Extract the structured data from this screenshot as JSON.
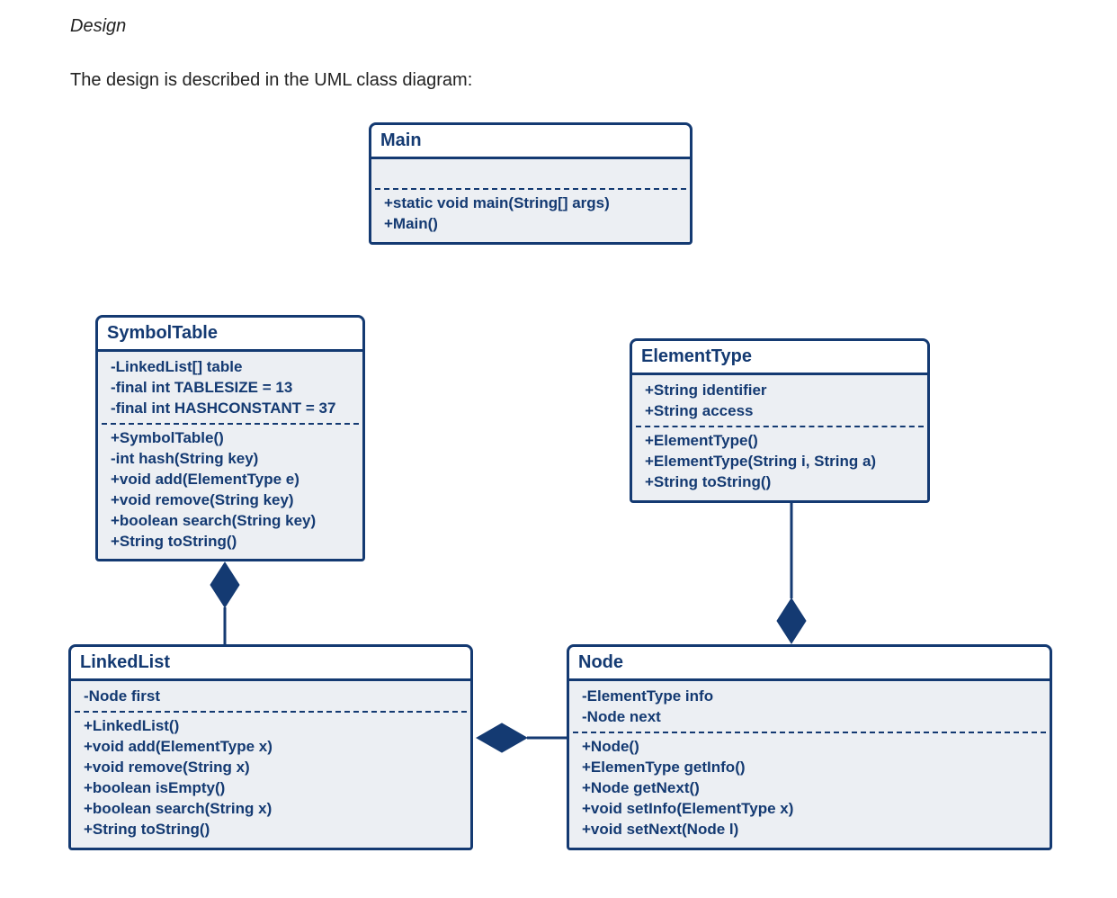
{
  "doc": {
    "heading": "Design",
    "intro": "The design is described in the UML class diagram:"
  },
  "classes": {
    "main": {
      "name": "Main",
      "attrs": [],
      "ops": [
        "+static void main(String[] args)",
        "+Main()"
      ]
    },
    "symbolTable": {
      "name": "SymbolTable",
      "attrs": [
        "-LinkedList[] table",
        "-final int TABLESIZE = 13",
        "-final int HASHCONSTANT = 37"
      ],
      "ops": [
        "+SymbolTable()",
        "-int hash(String key)",
        "+void add(ElementType e)",
        "+void remove(String key)",
        "+boolean search(String key)",
        "+String toString()"
      ]
    },
    "elementType": {
      "name": "ElementType",
      "attrs": [
        "+String identifier",
        "+String access"
      ],
      "ops": [
        "+ElementType()",
        "+ElementType(String i, String a)",
        "+String toString()"
      ]
    },
    "linkedList": {
      "name": "LinkedList",
      "attrs": [
        "-Node first"
      ],
      "ops": [
        "+LinkedList()",
        "+void add(ElementType x)",
        "+void remove(String x)",
        "+boolean isEmpty()",
        "+boolean search(String x)",
        "+String toString()"
      ]
    },
    "node": {
      "name": "Node",
      "attrs": [
        "-ElementType info",
        "-Node next"
      ],
      "ops": [
        "+Node()",
        "+ElemenType getInfo()",
        "+Node getNext()",
        "+void setInfo(ElementType x)",
        "+void setNext(Node l)"
      ]
    }
  }
}
